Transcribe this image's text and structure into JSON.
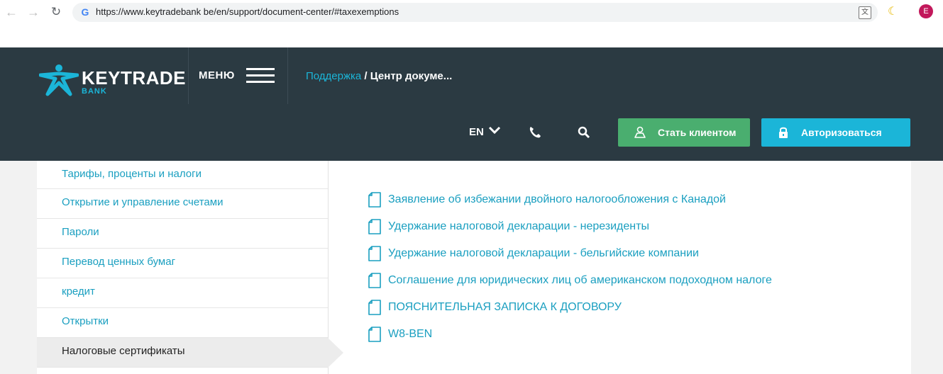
{
  "browser": {
    "url": "https://www.keytradebank be/en/support/document-center/#taxexemptions",
    "profile_initial": "E",
    "google_g": "G",
    "translate_glyph": "文"
  },
  "header": {
    "logo_text": "KEYTRADE",
    "logo_sub": "BANK",
    "menu_label": "МЕНЮ",
    "breadcrumb_link": "Поддержка",
    "breadcrumb_sep": " / ",
    "breadcrumb_current": "Центр докуме...",
    "lang": "EN",
    "btn_client": "Стать клиентом",
    "btn_login": "Авторизоваться"
  },
  "sidebar": {
    "items": [
      {
        "label": "Тарифы, проценты и налоги"
      },
      {
        "label": "Открытие и управление счетами"
      },
      {
        "label": "Пароли"
      },
      {
        "label": "Перевод ценных бумаг"
      },
      {
        "label": "кредит"
      },
      {
        "label": "Открытки"
      },
      {
        "label": "Налоговые сертификаты"
      }
    ]
  },
  "documents": [
    {
      "label": "Заявление об избежании двойного налогообложения с Канадой"
    },
    {
      "label": "Удержание налоговой декларации - нерезиденты"
    },
    {
      "label": "Удержание налоговой декларации - бельгийские компании"
    },
    {
      "label": "Соглашение для юридических лиц об американском подоходном налоге"
    },
    {
      "label": "ПОЯСНИТЕЛЬНАЯ ЗАПИСКА К ДОГОВОРУ"
    },
    {
      "label": "W8-BEN"
    }
  ],
  "colors": {
    "header_bg": "#2b3a42",
    "accent": "#1bb5d8",
    "green": "#4aae6f",
    "link": "#1a9fc0"
  }
}
